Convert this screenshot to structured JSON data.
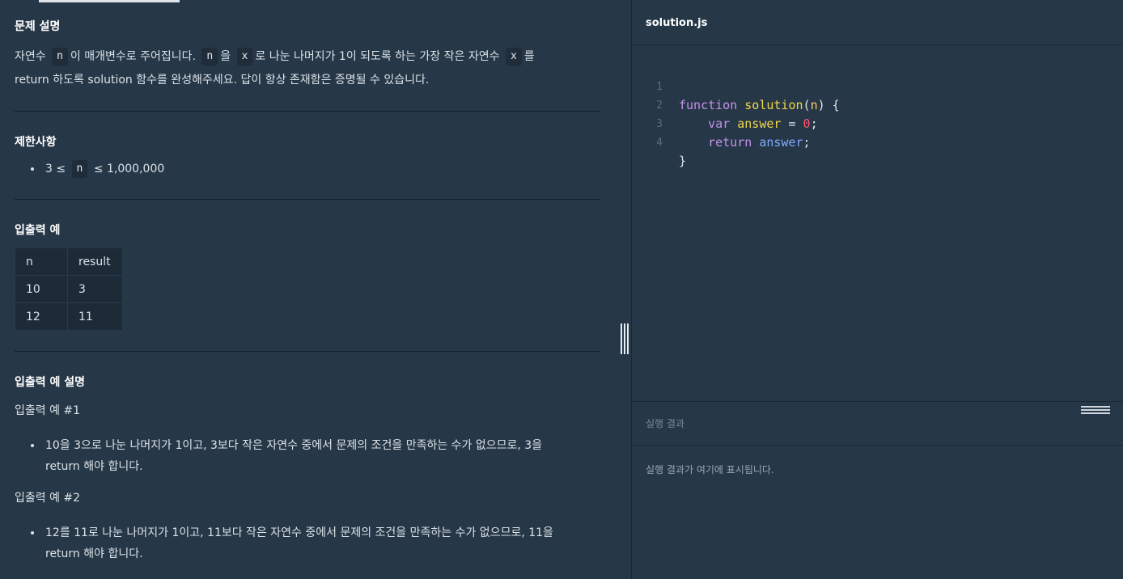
{
  "problem": {
    "section_title": "문제 설명",
    "desc_1a": "자연수",
    "desc_1b": "이 매개변수로 주어집니다.",
    "desc_1c": "을",
    "desc_1d": "로 나눈 나머지가 1이 되도록 하는 가장 작은 자연수",
    "desc_1e": "를",
    "desc_2": "return 하도록 solution 함수를 완성해주세요. 답이 항상 존재함은 증명될 수 있습니다.",
    "var_n": "n",
    "var_x": "x"
  },
  "constraints": {
    "title": "제한사항",
    "item_prefix": "3 ≤",
    "item_var": "n",
    "item_suffix": "≤ 1,000,000"
  },
  "io_example": {
    "title": "입출력 예",
    "headers": [
      "n",
      "result"
    ],
    "rows": [
      [
        "10",
        "3"
      ],
      [
        "12",
        "11"
      ]
    ]
  },
  "io_explanation": {
    "title": "입출력 예 설명",
    "ex1_title": "입출력 예 #1",
    "ex1_line1": "10을 3으로 나눈 나머지가 1이고, 3보다 작은 자연수 중에서 문제의 조건을 만족하는 수가 없으므로, 3을",
    "ex1_line2": "return 해야 합니다.",
    "ex2_title": "입출력 예 #2",
    "ex2_line1": "12를 11로 나눈 나머지가 1이고, 11보다 작은 자연수 중에서 문제의 조건을 만족하는 수가 없으므로, 11을",
    "ex2_line2": "return 해야 합니다."
  },
  "editor": {
    "filename": "solution.js",
    "line_numbers": [
      "1",
      "2",
      "3",
      "4"
    ],
    "line1": {
      "kw": "function",
      "fn": "solution",
      "rest": "(n) {",
      "paren_open": "(",
      "param": "n",
      "tail": ") {"
    },
    "line2": {
      "kw": "var",
      "name": "answer",
      "op": " = ",
      "num": "0",
      "end": ";"
    },
    "line3": {
      "kw": "return",
      "name": "answer",
      "end": ";"
    },
    "line4": {
      "text": "}"
    }
  },
  "result": {
    "title": "실행 결과",
    "placeholder": "실행 결과가 여기에 표시됩니다."
  }
}
